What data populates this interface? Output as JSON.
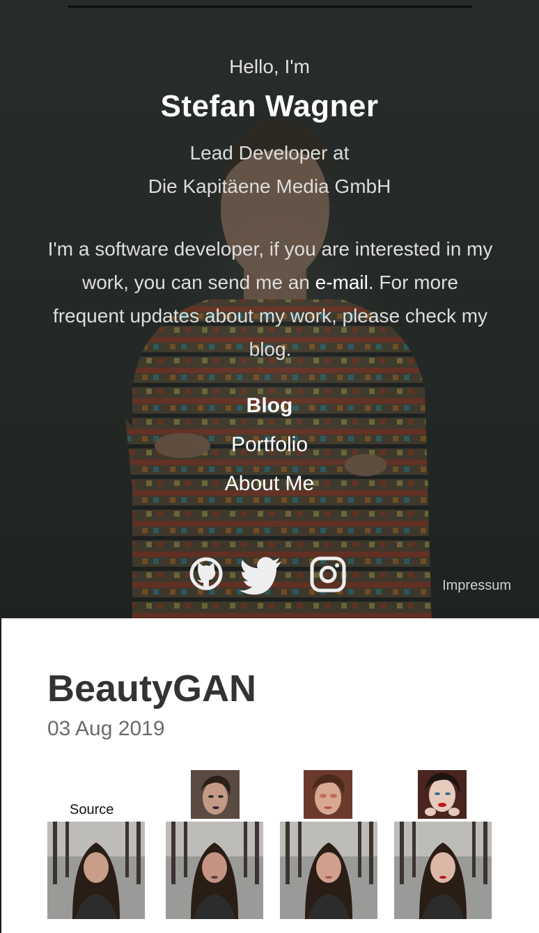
{
  "hero": {
    "greeting": "Hello, I'm",
    "name": "Stefan Wagner",
    "role_line1": "Lead Developer at",
    "role_line2": "Die Kapitäene Media GmbH",
    "intro_before": "I'm a software developer, if you are interested in my work, you can send me an ",
    "intro_link": "e-mail",
    "intro_after": ". For more frequent updates about my work, please check my blog.",
    "nav": {
      "blog": "Blog",
      "portfolio": "Portfolio",
      "about": "About Me"
    },
    "social_icons": [
      "github-icon",
      "twitter-icon",
      "instagram-icon"
    ],
    "impressum": "Impressum"
  },
  "post": {
    "title": "BeautyGAN",
    "date": "03 Aug 2019",
    "source_label": "Source"
  },
  "colors": {
    "hero_bg": "#2b2f2d",
    "title_text": "#333333",
    "date_text": "#6b6b6b"
  }
}
